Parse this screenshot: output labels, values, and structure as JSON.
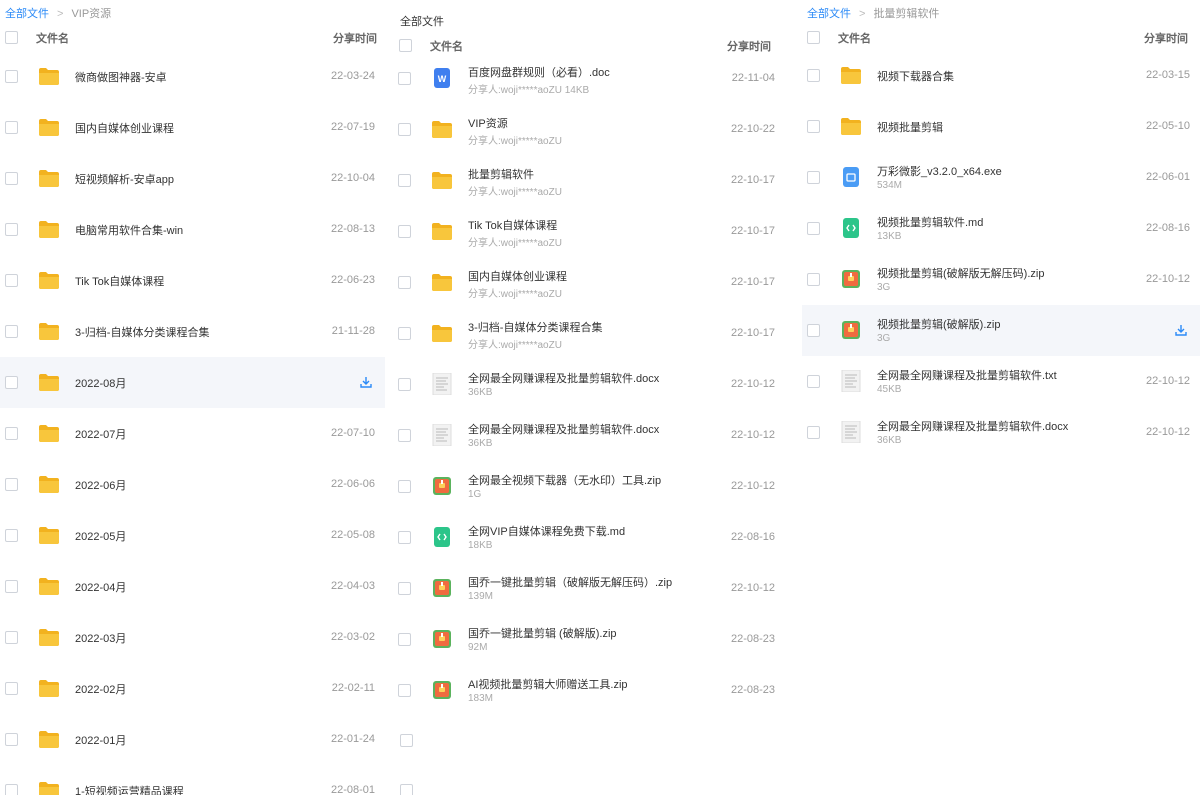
{
  "colors": {
    "accent": "#2b8af7",
    "folder": "#f8c63c",
    "folder_dark": "#f2b21f",
    "doc_blue": "#3f7fef",
    "md_green": "#2cc58a",
    "zip_orange": "#f06b3f",
    "exe_blue": "#4a9cf5"
  },
  "left": {
    "breadcrumb": {
      "root": "全部文件",
      "current": "VIP资源"
    },
    "header": {
      "name": "文件名",
      "time": "分享时间"
    },
    "rows": [
      {
        "name": "微商做图神器-安卓",
        "time": "22-03-24",
        "icon": "folder-icon"
      },
      {
        "name": "国内自媒体创业课程",
        "time": "22-07-19",
        "icon": "folder-icon"
      },
      {
        "name": "短视频解析-安卓app",
        "time": "22-10-04",
        "icon": "folder-icon"
      },
      {
        "name": "电脑常用软件合集-win",
        "time": "22-08-13",
        "icon": "folder-icon"
      },
      {
        "name": "Tik Tok自媒体课程",
        "time": "22-06-23",
        "icon": "folder-icon"
      },
      {
        "name": "3-归档-自媒体分类课程合集",
        "time": "21-11-28",
        "icon": "folder-icon"
      },
      {
        "name": "2022-08月",
        "time": "",
        "icon": "folder-icon",
        "highlight": true
      },
      {
        "name": "2022-07月",
        "time": "22-07-10",
        "icon": "folder-icon"
      },
      {
        "name": "2022-06月",
        "time": "22-06-06",
        "icon": "folder-icon"
      },
      {
        "name": "2022-05月",
        "time": "22-05-08",
        "icon": "folder-icon"
      },
      {
        "name": "2022-04月",
        "time": "22-04-03",
        "icon": "folder-icon"
      },
      {
        "name": "2022-03月",
        "time": "22-03-02",
        "icon": "folder-icon"
      },
      {
        "name": "2022-02月",
        "time": "22-02-11",
        "icon": "folder-icon"
      },
      {
        "name": "2022-01月",
        "time": "22-01-24",
        "icon": "folder-icon"
      },
      {
        "name": "1-短视频运营精品课程",
        "time": "22-08-01",
        "icon": "folder-icon"
      }
    ]
  },
  "mid": {
    "breadcrumb": {
      "root": "全部文件"
    },
    "header": {
      "name": "文件名",
      "time": "分享时间"
    },
    "rows": [
      {
        "name": "百度网盘群规则（必看）.doc",
        "sub": "分享人:woji*****aoZU 14KB",
        "time": "22-11-04",
        "icon": "word-doc-icon"
      },
      {
        "name": "VIP资源",
        "sub": "分享人:woji*****aoZU",
        "time": "22-10-22",
        "icon": "folder-icon"
      },
      {
        "name": "批量剪辑软件",
        "sub": "分享人:woji*****aoZU",
        "time": "22-10-17",
        "icon": "folder-icon"
      },
      {
        "name": "Tik Tok自媒体课程",
        "sub": "分享人:woji*****aoZU",
        "time": "22-10-17",
        "icon": "folder-icon"
      },
      {
        "name": "国内自媒体创业课程",
        "sub": "分享人:woji*****aoZU",
        "time": "22-10-17",
        "icon": "folder-icon"
      },
      {
        "name": "3-归档-自媒体分类课程合集",
        "sub": "分享人:woji*****aoZU",
        "time": "22-10-17",
        "icon": "folder-icon"
      },
      {
        "name": "全网最全网赚课程及批量剪辑软件.docx",
        "sub": "36KB",
        "time": "22-10-12",
        "icon": "doc-thumbnail-icon"
      },
      {
        "name": "全网最全网赚课程及批量剪辑软件.docx",
        "sub": "36KB",
        "time": "22-10-12",
        "icon": "doc-thumbnail-icon"
      },
      {
        "name": "全网最全视频下载器（无水印）工具.zip",
        "sub": "1G",
        "time": "22-10-12",
        "icon": "zip-icon"
      },
      {
        "name": "全网VIP自媒体课程免费下载.md",
        "sub": "18KB",
        "time": "22-08-16",
        "icon": "markdown-icon"
      },
      {
        "name": "国乔一键批量剪辑（破解版无解压码）.zip",
        "sub": "139M",
        "time": "22-10-12",
        "icon": "zip-icon"
      },
      {
        "name": "国乔一键批量剪辑 (破解版).zip",
        "sub": "92M",
        "time": "22-08-23",
        "icon": "zip-icon"
      },
      {
        "name": "AI视频批量剪辑大师赠送工具.zip",
        "sub": "183M",
        "time": "22-08-23",
        "icon": "zip-icon"
      }
    ]
  },
  "right": {
    "breadcrumb": {
      "root": "全部文件",
      "current": "批量剪辑软件"
    },
    "header": {
      "name": "文件名",
      "time": "分享时间"
    },
    "rows": [
      {
        "name": "视频下载器合集",
        "sub": "",
        "time": "22-03-15",
        "icon": "folder-icon"
      },
      {
        "name": "视频批量剪辑",
        "sub": "",
        "time": "22-05-10",
        "icon": "folder-icon"
      },
      {
        "name": "万彩微影_v3.2.0_x64.exe",
        "sub": "534M",
        "time": "22-06-01",
        "icon": "exe-icon"
      },
      {
        "name": "视频批量剪辑软件.md",
        "sub": "13KB",
        "time": "22-08-16",
        "icon": "markdown-icon"
      },
      {
        "name": "视频批量剪辑(破解版无解压码).zip",
        "sub": "3G",
        "time": "22-10-12",
        "icon": "zip-icon"
      },
      {
        "name": "视频批量剪辑(破解版).zip",
        "sub": "3G",
        "time": "",
        "icon": "zip-icon",
        "highlight": true
      },
      {
        "name": "全网最全网赚课程及批量剪辑软件.txt",
        "sub": "45KB",
        "time": "22-10-12",
        "icon": "doc-thumbnail-icon"
      },
      {
        "name": "全网最全网赚课程及批量剪辑软件.docx",
        "sub": "36KB",
        "time": "22-10-12",
        "icon": "doc-thumbnail-icon"
      }
    ]
  }
}
